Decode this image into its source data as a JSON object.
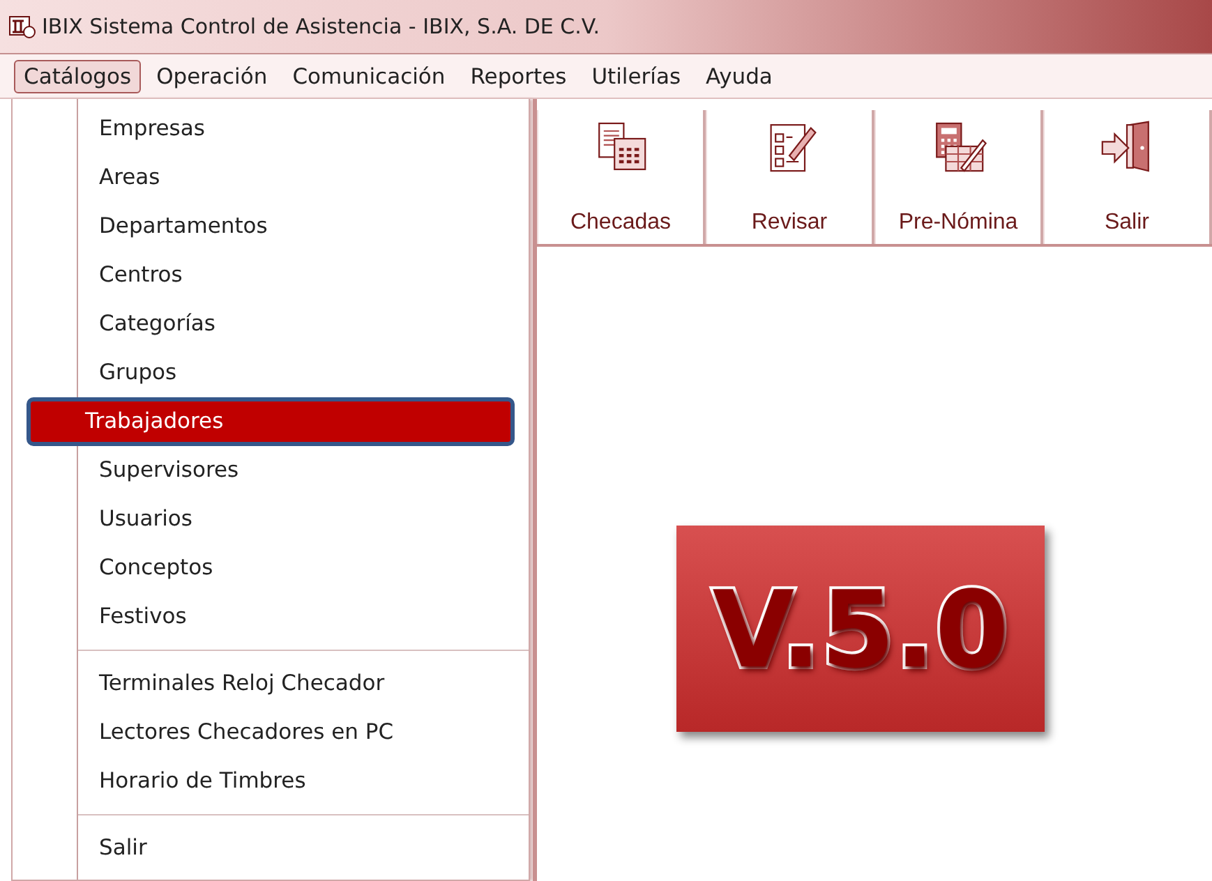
{
  "window": {
    "title": "IBIX Sistema Control de Asistencia - IBIX, S.A. DE C.V."
  },
  "menubar": [
    {
      "label": "Catálogos",
      "selected": true
    },
    {
      "label": "Operación",
      "selected": false
    },
    {
      "label": "Comunicación",
      "selected": false
    },
    {
      "label": "Reportes",
      "selected": false
    },
    {
      "label": "Utilerías",
      "selected": false
    },
    {
      "label": "Ayuda",
      "selected": false
    }
  ],
  "menu": {
    "items": [
      {
        "kind": "item",
        "label": "Empresas",
        "selected": false
      },
      {
        "kind": "item",
        "label": "Areas",
        "selected": false
      },
      {
        "kind": "item",
        "label": "Departamentos",
        "selected": false
      },
      {
        "kind": "item",
        "label": "Centros",
        "selected": false
      },
      {
        "kind": "item",
        "label": "Categorías",
        "selected": false
      },
      {
        "kind": "item",
        "label": "Grupos",
        "selected": false
      },
      {
        "kind": "item",
        "label": "Trabajadores",
        "selected": true
      },
      {
        "kind": "item",
        "label": "Supervisores",
        "selected": false
      },
      {
        "kind": "item",
        "label": "Usuarios",
        "selected": false
      },
      {
        "kind": "item",
        "label": "Conceptos",
        "selected": false
      },
      {
        "kind": "item",
        "label": "Festivos",
        "selected": false
      },
      {
        "kind": "separator"
      },
      {
        "kind": "item",
        "label": "Terminales Reloj Checador",
        "selected": false
      },
      {
        "kind": "item",
        "label": "Lectores Checadores en PC",
        "selected": false
      },
      {
        "kind": "item",
        "label": "Horario de Timbres",
        "selected": false
      },
      {
        "kind": "separator"
      },
      {
        "kind": "item",
        "label": "Salir",
        "selected": false
      }
    ]
  },
  "toolbar": [
    {
      "kind": "checadas",
      "label": "Checadas"
    },
    {
      "kind": "revisar",
      "label": "Revisar"
    },
    {
      "kind": "prenomina",
      "label": "Pre-Nómina"
    },
    {
      "kind": "salir",
      "label": "Salir"
    }
  ],
  "version_badge": {
    "text": "V.5.0"
  }
}
